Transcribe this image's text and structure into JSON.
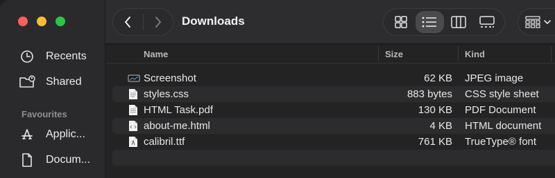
{
  "window": {
    "title": "Downloads"
  },
  "sidebar": {
    "items": [
      {
        "label": "Recents",
        "icon": "clock-icon"
      },
      {
        "label": "Shared",
        "icon": "shared-folder-icon"
      }
    ],
    "favourites_heading": "Favourites",
    "favourites": [
      {
        "label": "Applic...",
        "icon": "applications-icon"
      },
      {
        "label": "Docum...",
        "icon": "document-icon"
      }
    ]
  },
  "columns": {
    "name": "Name",
    "size": "Size",
    "kind": "Kind"
  },
  "files": [
    {
      "name": "Screenshot",
      "size": "62 KB",
      "kind": "JPEG image",
      "icon": "image-file-icon"
    },
    {
      "name": "styles.css",
      "size": "883 bytes",
      "kind": "CSS style sheet",
      "icon": "css-file-icon"
    },
    {
      "name": "HTML Task.pdf",
      "size": "130 KB",
      "kind": "PDF Document",
      "icon": "pdf-file-icon"
    },
    {
      "name": "about-me.html",
      "size": "4 KB",
      "kind": "HTML document",
      "icon": "html-file-icon"
    },
    {
      "name": "calibril.ttf",
      "size": "761 KB",
      "kind": "TrueType® font",
      "icon": "font-file-icon"
    }
  ],
  "colors": {
    "close": "#fe5f57",
    "minimize": "#febc2e",
    "zoom": "#28c840"
  }
}
